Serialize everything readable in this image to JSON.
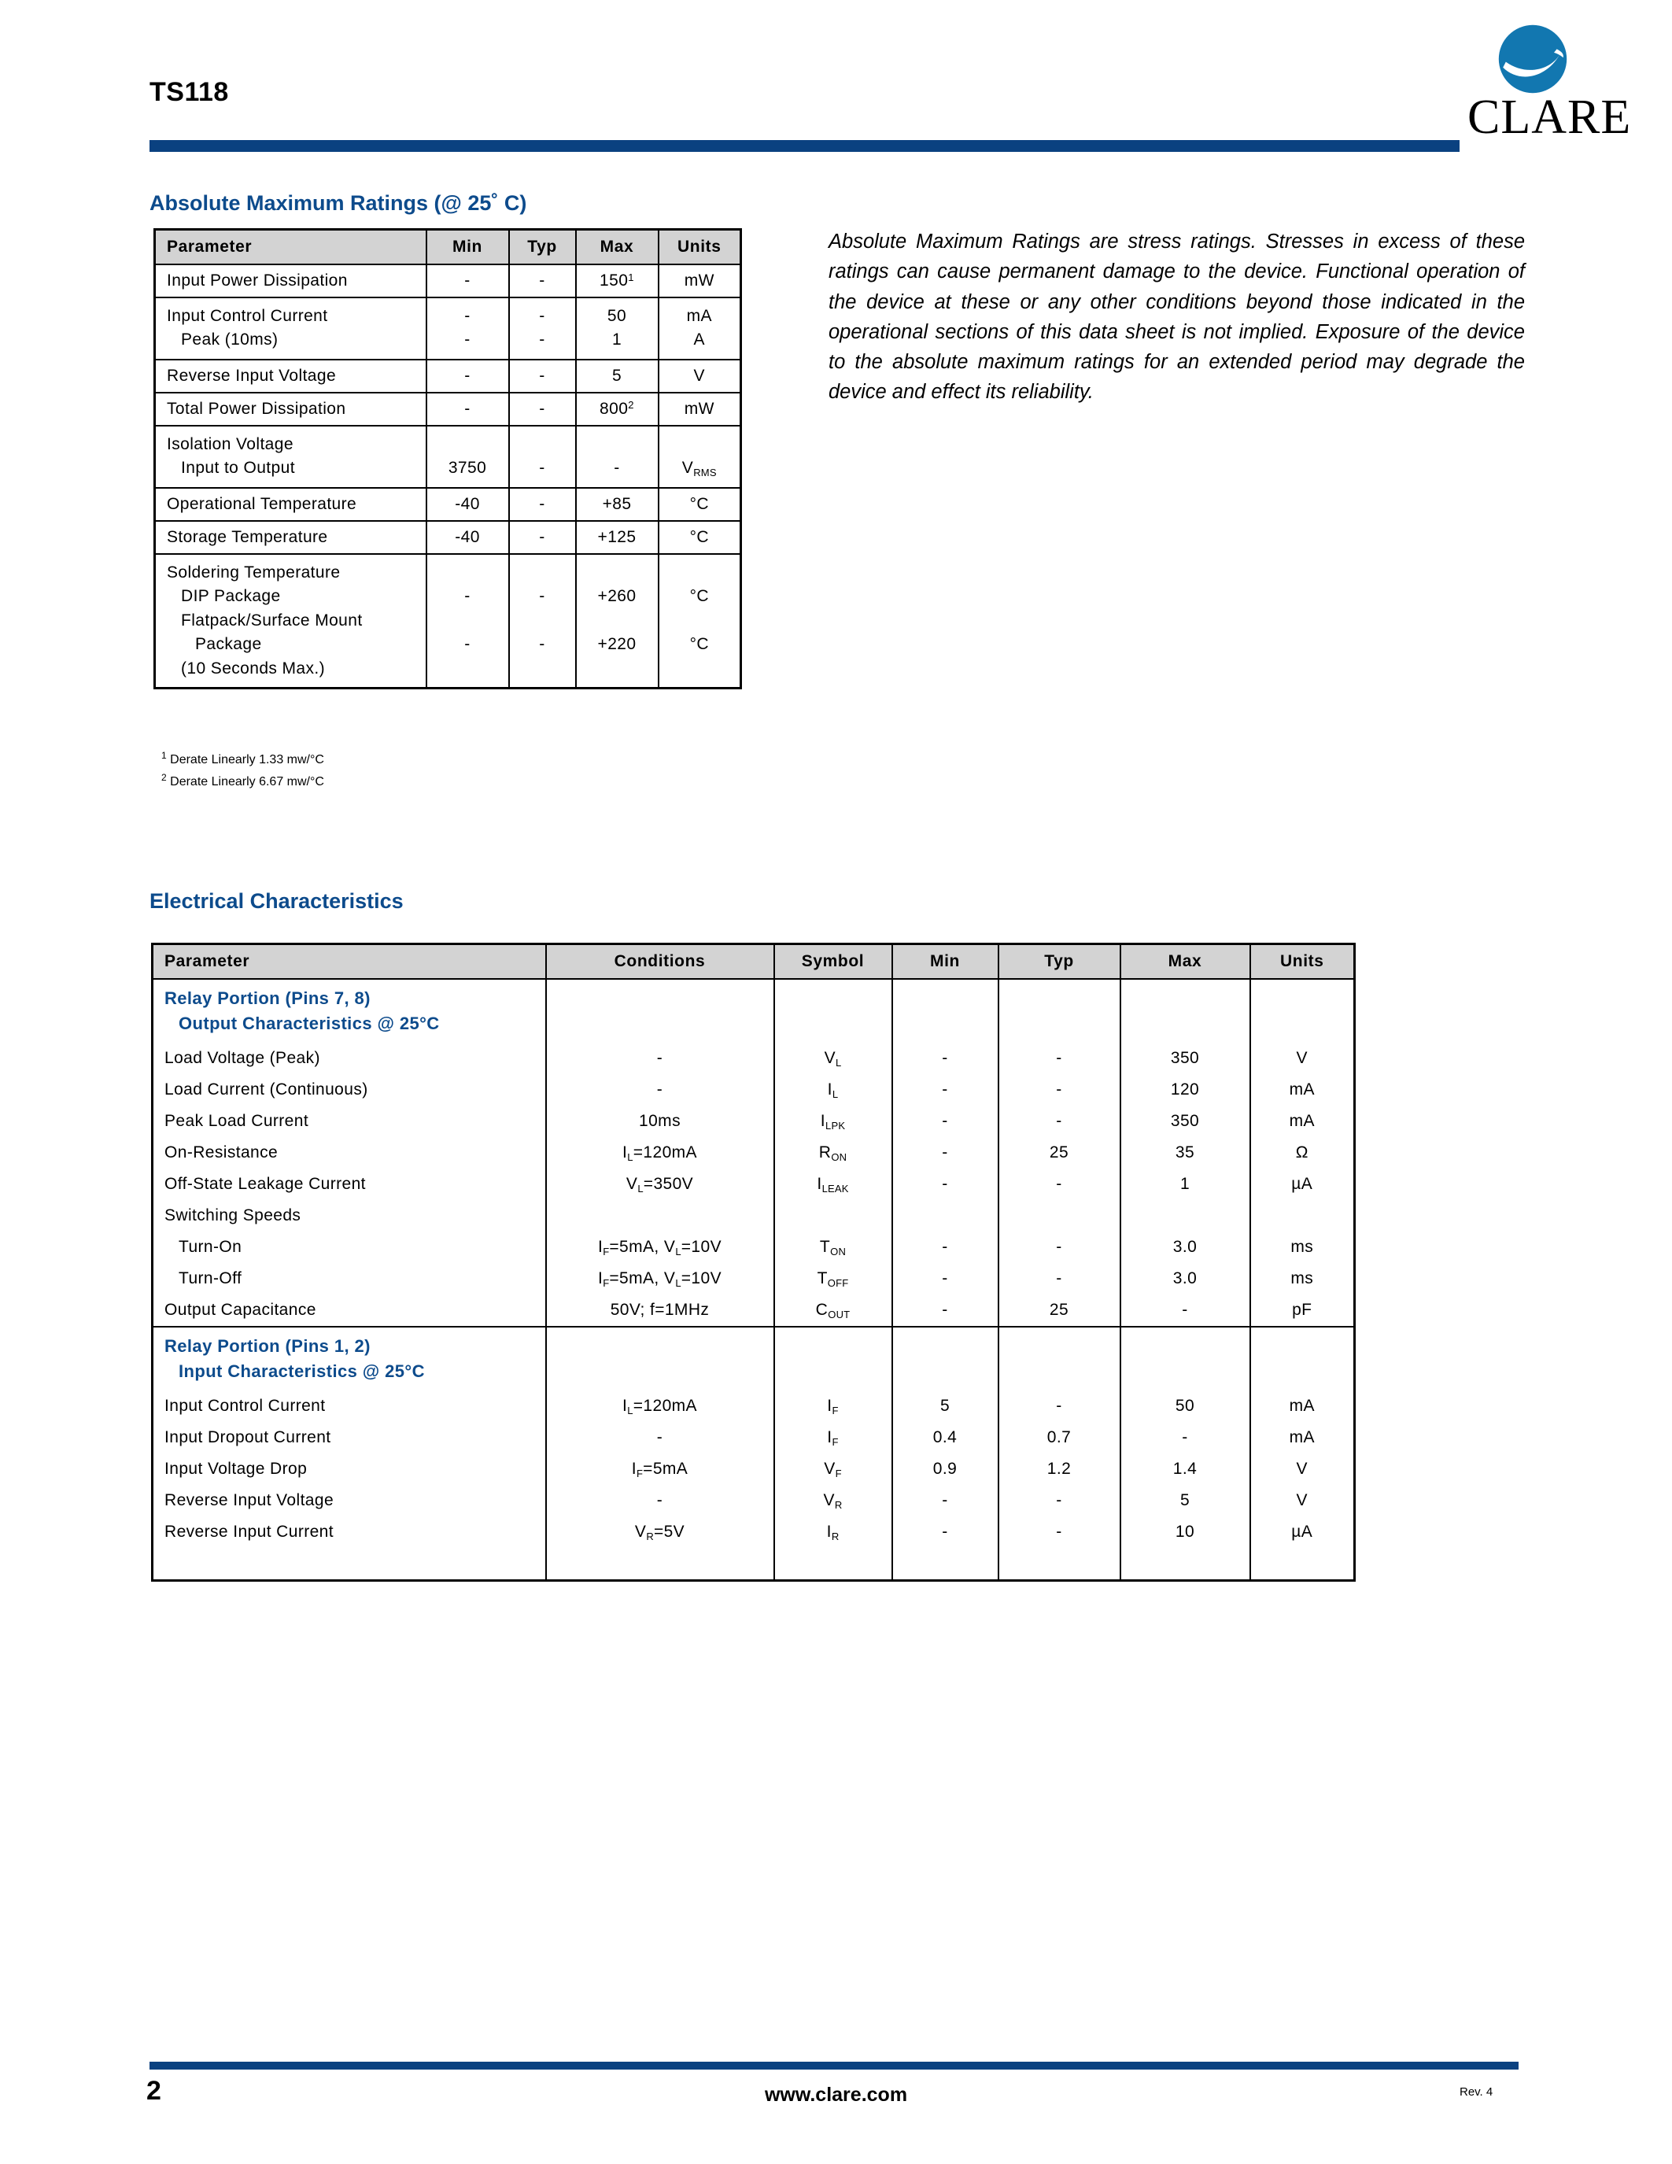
{
  "header": {
    "part_number": "TS118",
    "logo_text": "CLARE",
    "brand_color": "#0a4180",
    "heading_color": "#0d4b8c"
  },
  "absolute_maximum_ratings": {
    "heading": "Absolute Maximum Ratings (@ 25˚ C)",
    "columns": [
      "Parameter",
      "Min",
      "Typ",
      "Max",
      "Units"
    ],
    "rows": [
      {
        "lines": [
          "Input Power Dissipation"
        ],
        "min": [
          "-"
        ],
        "typ": [
          "-"
        ],
        "max": [
          "150¹"
        ],
        "units": [
          "mW"
        ]
      },
      {
        "lines": [
          "Input Control Current",
          "Peak (10ms)"
        ],
        "min": [
          "-",
          "-"
        ],
        "typ": [
          "-",
          "-"
        ],
        "max": [
          "50",
          "1"
        ],
        "units": [
          "mA",
          "A"
        ]
      },
      {
        "lines": [
          "Reverse Input Voltage"
        ],
        "min": [
          "-"
        ],
        "typ": [
          "-"
        ],
        "max": [
          "5"
        ],
        "units": [
          "V"
        ]
      },
      {
        "lines": [
          "Total Power Dissipation"
        ],
        "min": [
          "-"
        ],
        "typ": [
          "-"
        ],
        "max": [
          "800²"
        ],
        "units": [
          "mW"
        ]
      },
      {
        "lines": [
          "Isolation Voltage",
          "Input to Output"
        ],
        "min": [
          "",
          "3750"
        ],
        "typ": [
          "",
          "-"
        ],
        "max": [
          "",
          "-"
        ],
        "units": [
          "",
          "V_RMS"
        ]
      },
      {
        "lines": [
          "Operational Temperature"
        ],
        "min": [
          "-40"
        ],
        "typ": [
          "-"
        ],
        "max": [
          "+85"
        ],
        "units": [
          "°C"
        ]
      },
      {
        "lines": [
          "Storage Temperature"
        ],
        "min": [
          "-40"
        ],
        "typ": [
          "-"
        ],
        "max": [
          "+125"
        ],
        "units": [
          "°C"
        ]
      },
      {
        "lines": [
          "Soldering Temperature",
          "DIP Package",
          "Flatpack/Surface Mount",
          "Package",
          "(10 Seconds Max.)"
        ],
        "min": [
          "",
          "-",
          "",
          "-",
          ""
        ],
        "typ": [
          "",
          "-",
          "",
          "-",
          ""
        ],
        "max": [
          "",
          "+260",
          "",
          "+220",
          ""
        ],
        "units": [
          "",
          "°C",
          "",
          "°C",
          ""
        ]
      }
    ],
    "footnotes": [
      {
        "marker": "1",
        "text": "Derate Linearly 1.33 mw/°C"
      },
      {
        "marker": "2",
        "text": "Derate Linearly 6.67 mw/°C"
      }
    ]
  },
  "note": "Absolute Maximum Ratings are stress ratings. Stresses in excess of these ratings can cause permanent damage to the device. Functional operation of the device at these or any other conditions beyond those indicated in the operational sections of this data sheet is not implied. Exposure of the device to the absolute maximum ratings for an extended period may degrade the device and effect its reliability.",
  "electrical_characteristics": {
    "heading": "Electrical Characteristics",
    "columns": [
      "Parameter",
      "Conditions",
      "Symbol",
      "Min",
      "Typ",
      "Max",
      "Units"
    ],
    "section1": {
      "line1": "Relay Portion (Pins 7, 8)",
      "line2": "Output Characteristics @ 25°C"
    },
    "rows1": [
      {
        "parameter": "Load Voltage (Peak)",
        "conditions": "-",
        "symbol_base": "V",
        "symbol_sub": "L",
        "min": "-",
        "typ": "-",
        "max": "350",
        "units": "V"
      },
      {
        "parameter": "Load Current (Continuous)",
        "conditions": "-",
        "symbol_base": "I",
        "symbol_sub": "L",
        "min": "-",
        "typ": "-",
        "max": "120",
        "units": "mA"
      },
      {
        "parameter": "Peak Load Current",
        "conditions": "10ms",
        "symbol_base": "I",
        "symbol_sub": "LPK",
        "min": "-",
        "typ": "-",
        "max": "350",
        "units": "mA"
      },
      {
        "parameter": "On-Resistance",
        "conditions": "I_L=120mA",
        "symbol_base": "R",
        "symbol_sub": "ON",
        "min": "-",
        "typ": "25",
        "max": "35",
        "units": "Ω"
      },
      {
        "parameter": "Off-State Leakage Current",
        "conditions": "V_L=350V",
        "symbol_base": "I",
        "symbol_sub": "LEAK",
        "min": "-",
        "typ": "-",
        "max": "1",
        "units": "µA"
      }
    ],
    "switching_label": "Switching Speeds",
    "rows_switching": [
      {
        "parameter": "Turn-On",
        "conditions": "I_F=5mA, V_L=10V",
        "symbol_base": "T",
        "symbol_sub": "ON",
        "min": "-",
        "typ": "-",
        "max": "3.0",
        "units": "ms"
      },
      {
        "parameter": "Turn-Off",
        "conditions": "I_F=5mA, V_L=10V",
        "symbol_base": "T",
        "symbol_sub": "OFF",
        "min": "-",
        "typ": "-",
        "max": "3.0",
        "units": "ms"
      }
    ],
    "rows1b": [
      {
        "parameter": "Output Capacitance",
        "conditions": "50V; f=1MHz",
        "symbol_base": "C",
        "symbol_sub": "OUT",
        "min": "-",
        "typ": "25",
        "max": "-",
        "units": "pF"
      }
    ],
    "section2": {
      "line1": "Relay Portion (Pins 1, 2)",
      "line2": "Input Characteristics @ 25°C"
    },
    "rows2": [
      {
        "parameter": "Input Control Current",
        "conditions": "I_L=120mA",
        "symbol_base": "I",
        "symbol_sub": "F",
        "min": "5",
        "typ": "-",
        "max": "50",
        "units": "mA"
      },
      {
        "parameter": "Input Dropout Current",
        "conditions": "-",
        "symbol_base": "I",
        "symbol_sub": "F",
        "min": "0.4",
        "typ": "0.7",
        "max": "-",
        "units": "mA"
      },
      {
        "parameter": "Input Voltage Drop",
        "conditions": "I_F=5mA",
        "symbol_base": "V",
        "symbol_sub": "F",
        "min": "0.9",
        "typ": "1.2",
        "max": "1.4",
        "units": "V"
      },
      {
        "parameter": "Reverse Input Voltage",
        "conditions": "-",
        "symbol_base": "V",
        "symbol_sub": "R",
        "min": "-",
        "typ": "-",
        "max": "5",
        "units": "V"
      },
      {
        "parameter": "Reverse Input Current",
        "conditions": "V_R=5V",
        "symbol_base": "I",
        "symbol_sub": "R",
        "min": "-",
        "typ": "-",
        "max": "10",
        "units": "µA"
      }
    ]
  },
  "footer": {
    "page_number": "2",
    "url": "www.clare.com",
    "revision": "Rev. 4"
  }
}
